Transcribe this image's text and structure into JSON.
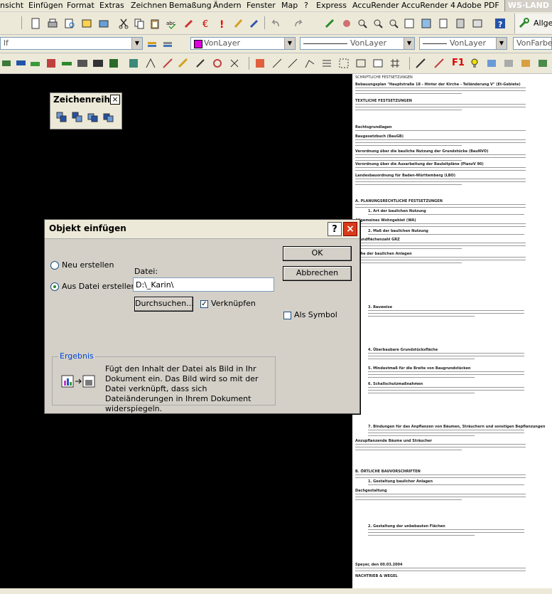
{
  "menu": [
    "nsicht",
    "Einfügen",
    "Format",
    "Extras",
    "Zeichnen",
    "Bemaßung",
    "Ändern",
    "Fenster",
    "Map",
    "?",
    "Express",
    "AccuRender",
    "AccuRender 4",
    "Adobe PDF"
  ],
  "brand": "WS·LAND",
  "toolbar": {
    "layer_combo": "lf",
    "color_combo": "VonLayer",
    "linetype_combo": "VonLayer",
    "lineweight_combo": "VonLayer",
    "plotstyle_combo": "VonFarbe",
    "right_label": "Allger",
    "f1_label": "F1"
  },
  "palette": {
    "title": "Zeichenreihen",
    "close": "×"
  },
  "dialog": {
    "title": "Objekt einfügen",
    "help": "?",
    "close": "×",
    "radio_new": "Neu erstellen",
    "radio_file": "Aus Datei erstellen",
    "file_label": "Datei:",
    "file_value": "D:\\_Karin\\",
    "browse": "Durchsuchen...",
    "link_label": "Verknüpfen",
    "ok": "OK",
    "cancel": "Abbrechen",
    "symbol_label": "Als Symbol",
    "result_title": "Ergebnis",
    "result_text": "Fügt den Inhalt der Datei als Bild in Ihr Dokument ein. Das Bild wird so mit der Datei verknüpft, dass sich Dateiänderungen in Ihrem Dokument widerspiegeln."
  },
  "doc": {
    "heading": "SCHRIFTLICHE FESTSETZUNGEN",
    "sections": [
      "Bebauungsplan \"Hauptstraße 18 - Hinter der Kirche - Teiländerung V\" (Et-Gebiete)",
      "TEXTLICHE FESTSETZUNGEN",
      "Rechtsgrundlagen",
      "Baugesetzbuch (BauGB)",
      "Verordnung über die bauliche Nutzung der Grundstücke (BauNVO)",
      "Verordnung über die Ausarbeitung der Bauleitpläne (PlanzV 90)",
      "Landesbauordnung für Baden-Württemberg (LBO)",
      "A. PLANUNGSRECHTLICHE FESTSETZUNGEN",
      "1. Art der baulichen Nutzung",
      "Allgemeines Wohngebiet (WA)",
      "2. Maß der baulichen Nutzung",
      "Grundflächenzahl GRZ",
      "Höhe der baulichen Anlagen",
      "3. Bauweise",
      "4. Überbaubare Grundstücksfläche",
      "5. Mindestmaß für die Breite von Baugrundstücken",
      "6. Schallschutzmaßnahmen",
      "7. Bindungen für das Anpflanzen von Bäumen, Sträuchern und sonstigen Bepflanzungen",
      "Anzupflanzende Bäume und Sträucher",
      "B. ÖRTLICHE BAUVORSCHRIFTEN",
      "1. Gestaltung baulicher Anlagen",
      "Dachgestaltung",
      "2. Gestaltung der unbebauten Flächen",
      "Speyer, den 00.03.2004",
      "NACHTRIEB & WEGEL"
    ]
  }
}
